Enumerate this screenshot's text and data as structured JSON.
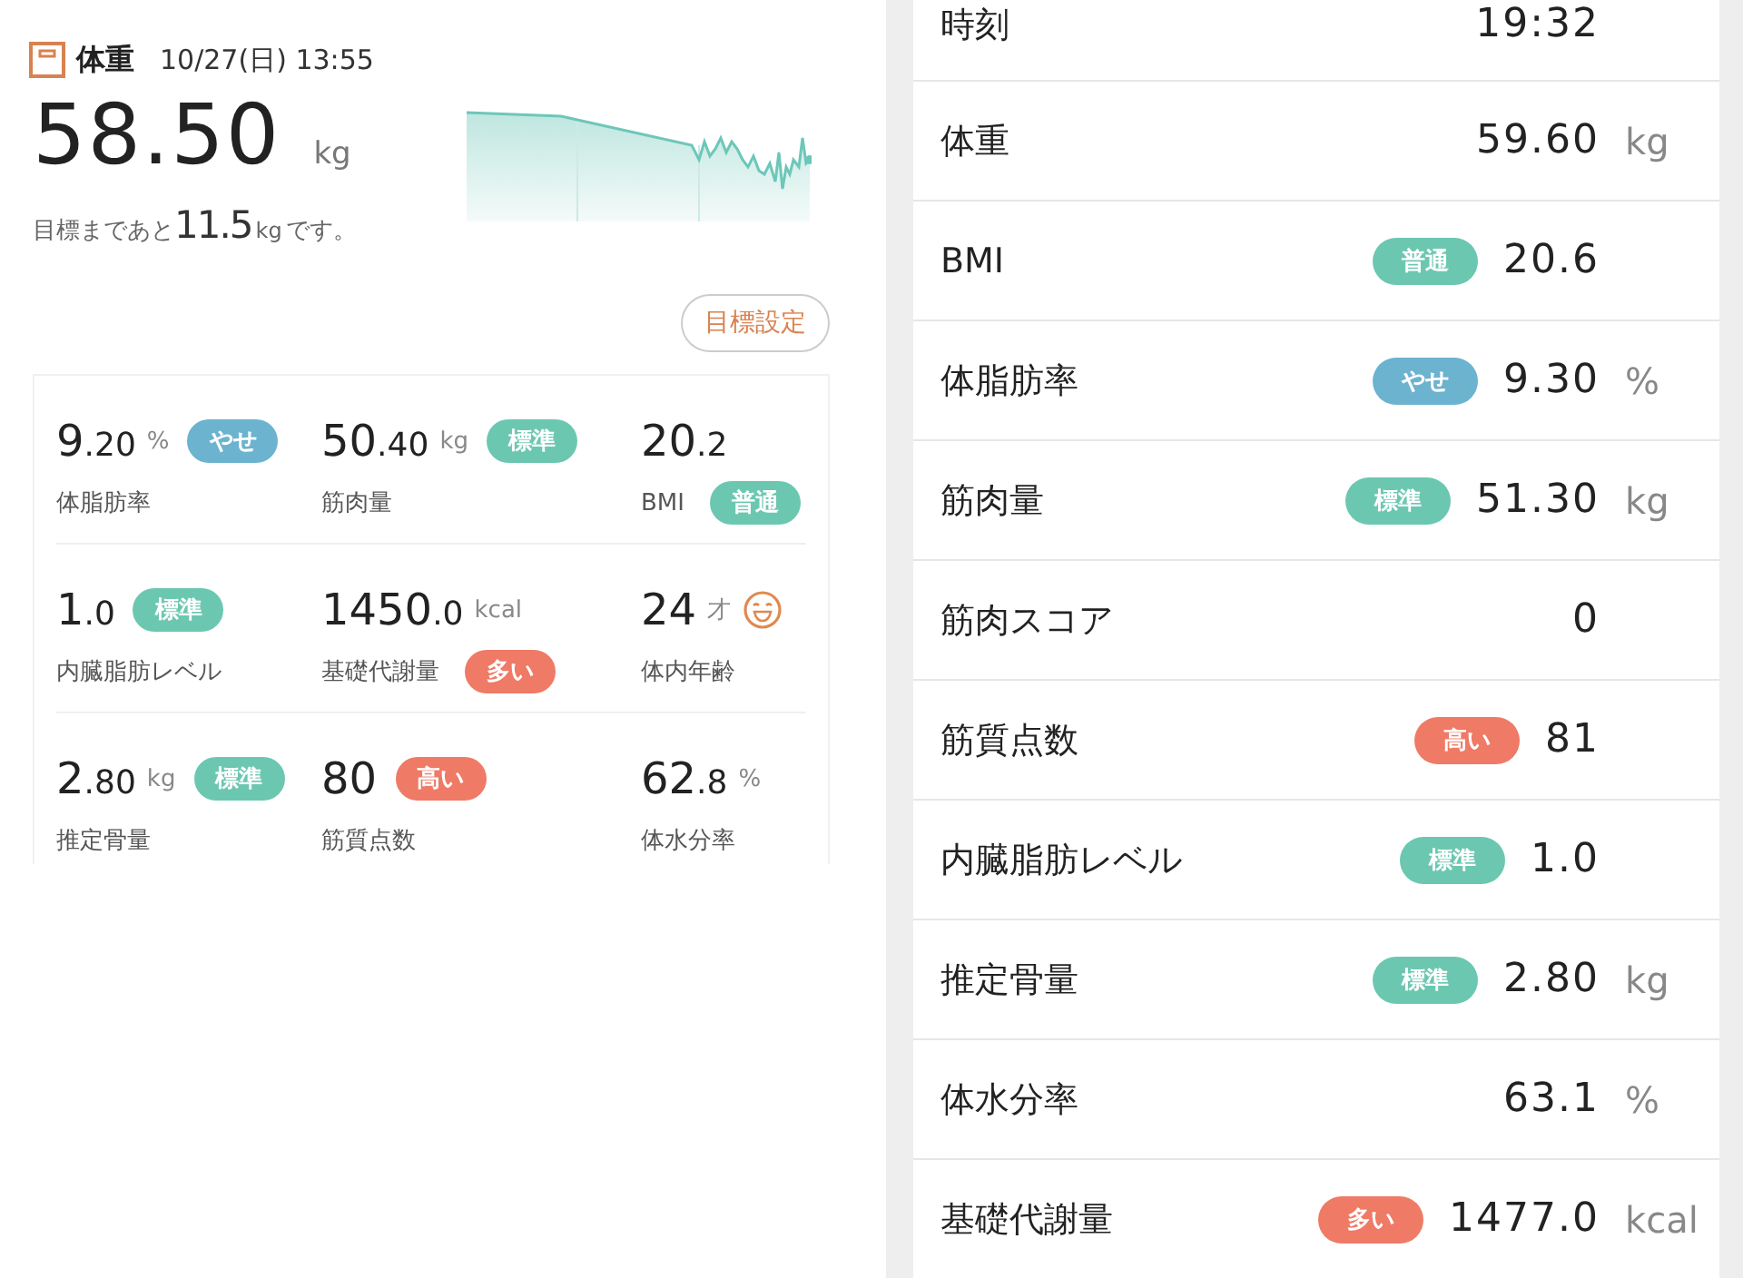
{
  "summary": {
    "title": "体重",
    "date": "10/27(日) 13:55",
    "weight": {
      "whole": "58",
      "decimal": ".50",
      "unit": "kg"
    },
    "goal": {
      "before": "目標まであと",
      "value": "11.5",
      "unit": "kg",
      "after": "です。"
    },
    "goal_button": "目標設定",
    "metrics": [
      [
        {
          "whole": "9",
          "decimal": ".20",
          "unit": "%",
          "label": "体脂肪率",
          "badge": {
            "text": "やせ",
            "color": "#6cb3cf"
          },
          "kind": "upper"
        },
        {
          "whole": "50",
          "decimal": ".40",
          "unit": "kg",
          "label": "筋肉量",
          "badge": {
            "text": "標準",
            "color": "#6cc7b1"
          },
          "kind": "upper"
        },
        {
          "whole": "20",
          "decimal": ".2",
          "label": "BMI",
          "badge": {
            "text": "普通",
            "color": "#6cc7b1"
          },
          "kind": "lower"
        }
      ],
      [
        {
          "whole": "1",
          "decimal": ".0",
          "label": "内臓脂肪レベル",
          "badge": {
            "text": "標準",
            "color": "#6cc7b1"
          },
          "kind": "upper"
        },
        {
          "whole": "1450",
          "decimal": ".0",
          "unit": "kcal",
          "label": "基礎代謝量",
          "badge": {
            "text": "多い",
            "color": "#ef7a66"
          },
          "kind": "lower"
        },
        {
          "whole": "24",
          "unit": "才",
          "label": "体内年齢",
          "kind": "face"
        }
      ],
      [
        {
          "whole": "2",
          "decimal": ".80",
          "unit": "kg",
          "label": "推定骨量",
          "badge": {
            "text": "標準",
            "color": "#6cc7b1"
          },
          "kind": "upper"
        },
        {
          "whole": "80",
          "label": "筋質点数",
          "badge": {
            "text": "高い",
            "color": "#ef7a66"
          },
          "kind": "upper"
        },
        {
          "whole": "62",
          "decimal": ".8",
          "unit": "%",
          "label": "体水分率"
        }
      ]
    ]
  },
  "detail_rows": [
    {
      "label": "時刻",
      "value": "19:32"
    },
    {
      "label": "体重",
      "value": "59.60",
      "unit": "kg"
    },
    {
      "label": "BMI",
      "value": "20.6",
      "badge": {
        "text": "普通",
        "color": "#6cc7b1"
      }
    },
    {
      "label": "体脂肪率",
      "value": "9.30",
      "unit": "%",
      "badge": {
        "text": "やせ",
        "color": "#6cb3cf"
      }
    },
    {
      "label": "筋肉量",
      "value": "51.30",
      "unit": "kg",
      "badge": {
        "text": "標準",
        "color": "#6cc7b1"
      }
    },
    {
      "label": "筋肉スコア",
      "value": "0"
    },
    {
      "label": "筋質点数",
      "value": "81",
      "badge": {
        "text": "高い",
        "color": "#ef7a66"
      }
    },
    {
      "label": "内臓脂肪レベル",
      "value": "1.0",
      "badge": {
        "text": "標準",
        "color": "#6cc7b1"
      }
    },
    {
      "label": "推定骨量",
      "value": "2.80",
      "unit": "kg",
      "badge": {
        "text": "標準",
        "color": "#6cc7b1"
      }
    },
    {
      "label": "体水分率",
      "value": "63.1",
      "unit": "%"
    },
    {
      "label": "基礎代謝量",
      "value": "1477.0",
      "unit": "kcal",
      "badge": {
        "text": "多い",
        "color": "#ef7a66"
      }
    }
  ]
}
